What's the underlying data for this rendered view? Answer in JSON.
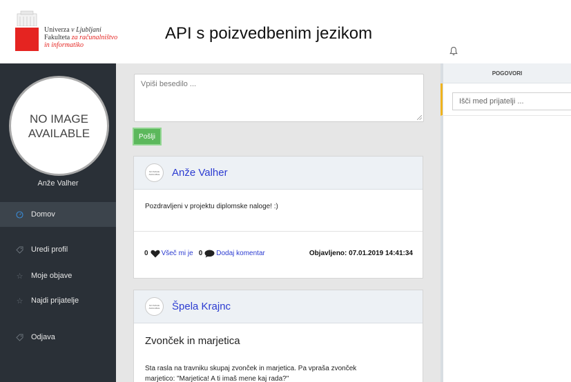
{
  "header": {
    "logo": {
      "line1_a": "Univerza ",
      "line1_b": "v Ljubljani",
      "line2_a": "Fakulteta ",
      "line2_b": "za računalništvo",
      "line3": "in informatiko",
      "accent_color": "#e52421"
    },
    "title": "API s poizvedbenim jezikom",
    "bell_icon": "bell-icon"
  },
  "sidebar": {
    "avatar_text_1": "NO IMAGE",
    "avatar_text_2": "AVAILABLE",
    "user_name": "Anže Valher",
    "items": [
      {
        "label": "Domov",
        "icon": "gauge-icon",
        "active": true
      },
      {
        "label": "Uredi profil",
        "icon": "tag-icon"
      },
      {
        "label": "Moje objave",
        "icon": "star-icon"
      },
      {
        "label": "Najdi prijatelje",
        "icon": "star-icon"
      },
      {
        "label": "Odjava",
        "icon": "tag-icon"
      }
    ]
  },
  "feed": {
    "compose_placeholder": "Vpiši besedilo ...",
    "send_label": "Pošlji",
    "posts": [
      {
        "avatar_text": "NO IMAGE AVAILABLE",
        "author": "Anže Valher",
        "body": "Pozdravljeni v projektu diplomske naloge! :)",
        "likes": "0",
        "like_label": "Všeč mi je",
        "comments": "0",
        "comment_label": "Dodaj komentar",
        "published": "Objavljeno: 07.01.2019 14:41:34"
      },
      {
        "avatar_text": "NO IMAGE AVAILABLE",
        "author": "Špela Krajnc",
        "title": "Zvonček in marjetica",
        "text_line1": "Sta rasla na travniku skupaj zvonček in marjetica. Pa vpraša zvonček",
        "text_line2": "marjetico: \"Marjetica! A ti imaš mene kaj rada?\""
      }
    ]
  },
  "right_panel": {
    "title": "POGOVORI",
    "search_placeholder": "Išči med prijatelji ...",
    "accent_color": "#f0b41e"
  }
}
